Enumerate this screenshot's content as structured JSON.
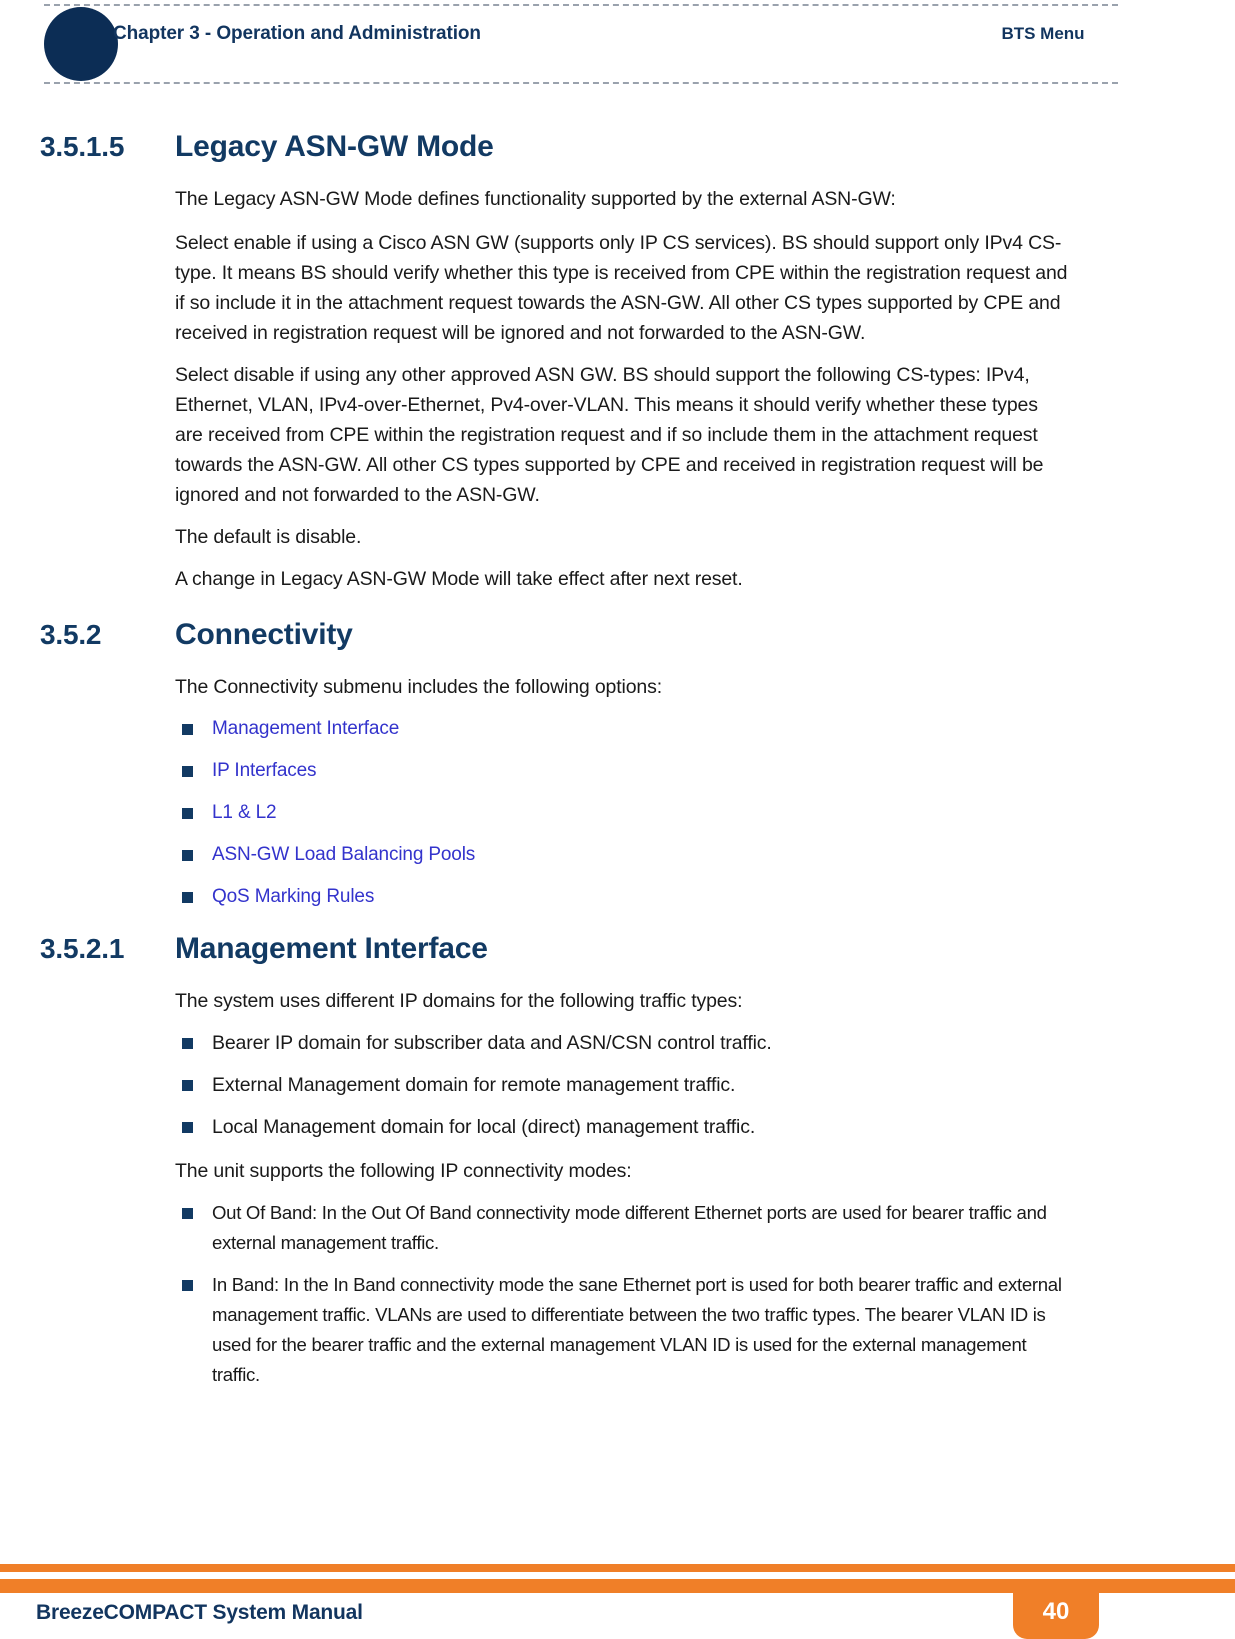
{
  "header": {
    "chapter": "Chapter 3 - Operation and Administration",
    "section": "BTS Menu"
  },
  "footer": {
    "manual_title": "BreezeCOMPACT System Manual",
    "page_number": "40"
  },
  "colors": {
    "navy": "#12355f",
    "dark_navy": "#0c2d55",
    "link_blue": "#3333cc",
    "orange": "#f07f28",
    "body_text": "#1a1a1a",
    "dashed_rule": "#9aa2ad"
  },
  "sections": {
    "legacy_asn_gw": {
      "number": "3.5.1.5",
      "title": "Legacy ASN-GW Mode",
      "p1": "The Legacy ASN-GW Mode defines functionality supported by the external ASN-GW:",
      "p2": "Select enable if using a Cisco ASN GW (supports only IP CS services). BS should support only IPv4 CS-type. It means BS should verify whether this type is received from CPE within the registration request and if so include it in the attachment request towards the ASN-GW. All other CS types supported by CPE and received in registration request will be ignored and not forwarded to the ASN-GW.",
      "p3": "Select disable if using any other approved ASN GW. BS should support the following CS-types: IPv4, Ethernet, VLAN, IPv4-over-Ethernet, Pv4-over-VLAN. This means it should verify whether these types are received from CPE within the registration request and if so include them in the attachment request towards the ASN-GW. All other CS types supported by CPE and received in registration request will be ignored and not forwarded to the ASN-GW.",
      "p4": "The default is disable.",
      "p5": "A change in Legacy ASN-GW Mode will take effect after next reset."
    },
    "connectivity": {
      "number": "3.5.2",
      "title": "Connectivity",
      "intro": "The Connectivity submenu includes the following options:",
      "links": [
        "Management Interface",
        "IP Interfaces",
        "L1 & L2",
        "ASN-GW Load Balancing Pools",
        "QoS Marking Rules"
      ]
    },
    "management_interface": {
      "number": "3.5.2.1",
      "title": "Management Interface",
      "intro_domains": "The system uses different IP domains for the following traffic types:",
      "domains": [
        "Bearer IP domain for subscriber data and ASN/CSN control traffic.",
        "External Management domain for remote management traffic.",
        "Local Management domain for local (direct) management traffic."
      ],
      "intro_modes": "The unit supports the following IP connectivity modes:",
      "modes": [
        "Out Of Band: In the Out Of Band connectivity mode different Ethernet ports are used for bearer traffic and external management traffic.",
        "In Band: In the In Band connectivity mode the sane Ethernet port is used for both bearer traffic and external management traffic. VLANs are used to differentiate between the two traffic types. The bearer VLAN ID is used for the bearer traffic and the external management VLAN ID is used for the external management traffic."
      ]
    }
  }
}
